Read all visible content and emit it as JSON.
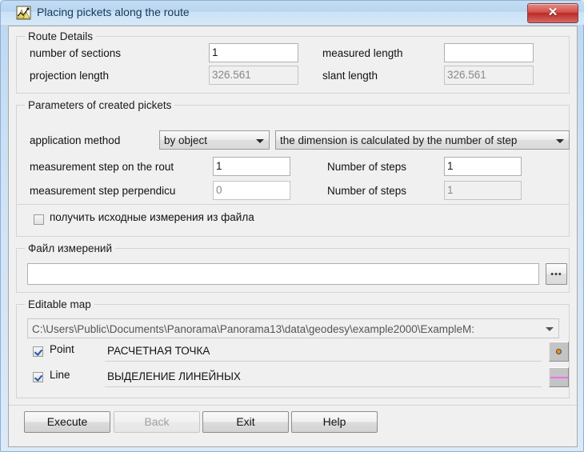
{
  "window": {
    "title": "Placing pickets along the route",
    "icon": "route-map-icon",
    "close_label": "✕"
  },
  "route_details": {
    "group_label": "Route Details",
    "number_of_sections_label": "number of sections",
    "number_of_sections_value": "1",
    "projection_length_label": "projection length",
    "projection_length_value": "326.561",
    "measured_length_label": "measured length",
    "measured_length_value": "",
    "slant_length_label": "slant length",
    "slant_length_value": "326.561"
  },
  "picket_params": {
    "group_label": "Parameters of created pickets",
    "application_method_label": "application method",
    "application_method_value": "by object",
    "dimension_mode_value": "the dimension is calculated by the number of step",
    "step_route_label": "measurement step on the rout",
    "step_route_value": "1",
    "step_perp_label": "measurement step perpendicu",
    "step_perp_value": "0",
    "number_of_steps_label_1": "Number of steps",
    "number_of_steps_value_1": "1",
    "number_of_steps_label_2": "Number of steps",
    "number_of_steps_value_2": "1",
    "source_from_file_label": "получить исходные измерения из файла",
    "source_from_file_checked": false
  },
  "measurement_file": {
    "group_label": "Файл измерений",
    "path_value": "",
    "browse_label": "•••"
  },
  "editable_map": {
    "group_label": "Editable map",
    "map_path": "C:\\Users\\Public\\Documents\\Panorama\\Panorama13\\data\\geodesy\\example2000\\ExampleM:",
    "point_label": "Point",
    "point_checked": true,
    "point_object": "РАСЧЕТНАЯ ТОЧКА",
    "point_color": "#ef8a1c",
    "line_label": "Line",
    "line_checked": true,
    "line_object": "ВЫДЕЛЕНИЕ ЛИНЕЙНЫХ",
    "line_color": "#f06ef0"
  },
  "buttons": {
    "execute": "Execute",
    "back": "Back",
    "exit": "Exit",
    "help": "Help"
  },
  "colors": {
    "titlebar": "#b8d4ef",
    "close_red": "#bb2a25",
    "client_bg": "#f0f0f0"
  }
}
